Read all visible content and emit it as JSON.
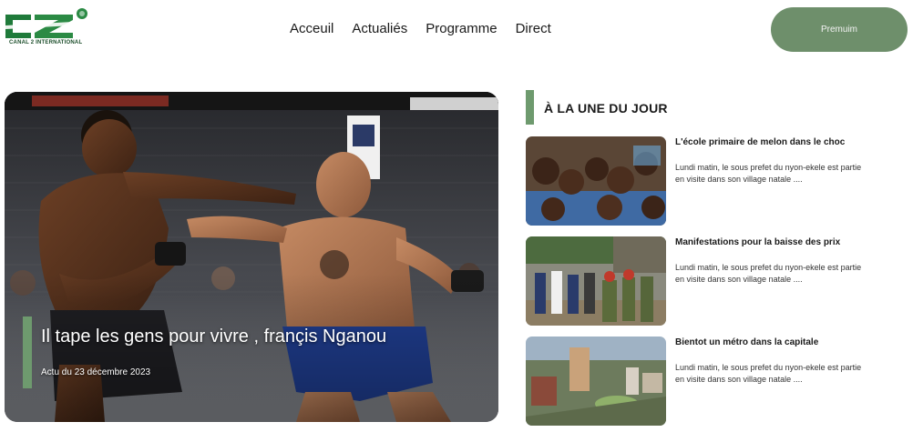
{
  "brand": {
    "name": "CANAL 2 INTERNATIONAL"
  },
  "nav": {
    "items": [
      "Acceuil",
      "Actualiés",
      "Programme",
      "Direct"
    ]
  },
  "premium_label": "Premuim",
  "hero": {
    "title": "Il tape les gens pour vivre , françis Nganou",
    "date": "Actu du 23 décembre 2023"
  },
  "section": {
    "title": "À LA UNE DU JOUR"
  },
  "articles": [
    {
      "headline": "L'école primaire de melon dans le choc",
      "excerpt": "Lundi matin, le sous prefet du nyon-ekele est partie en visite dans son village natale ...."
    },
    {
      "headline": "Manifestations pour la baisse des prix",
      "excerpt": "Lundi matin, le sous prefet du nyon-ekele est partie en visite dans son village natale ...."
    },
    {
      "headline": "Bientot un métro dans la capitale",
      "excerpt": "Lundi matin, le sous prefet du nyon-ekele est partie en visite dans son village natale ...."
    }
  ],
  "colors": {
    "accent": "#6e9a6e",
    "premium": "#6e8f6b",
    "logo_green": "#1f7a3a"
  }
}
